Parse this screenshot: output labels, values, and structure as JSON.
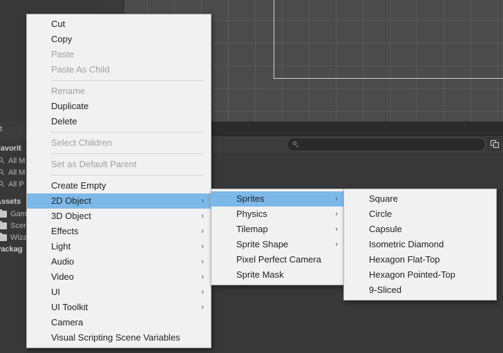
{
  "editor": {
    "project_panel": {
      "tab_label": "oject",
      "favorites_header": "Favorit",
      "favorites": [
        {
          "icon": "search-icon",
          "label": "All M"
        },
        {
          "icon": "search-icon",
          "label": "All M"
        },
        {
          "icon": "search-icon",
          "label": "All P"
        }
      ],
      "assets_header": "Assets",
      "assets": [
        {
          "icon": "folder-icon",
          "label": "Gam"
        },
        {
          "icon": "folder-icon",
          "label": "Scen"
        },
        {
          "icon": "folder-icon",
          "label": "Wiza"
        }
      ],
      "packages_header": "Packag"
    },
    "toolbar": {
      "search_placeholder": "",
      "search_value": "",
      "search_icon": "search-icon",
      "right_icon": "two-column-layout-icon"
    },
    "scene_view": {
      "grid": true,
      "camera_bounds": true
    }
  },
  "colors": {
    "menu_bg": "#f1f1f1",
    "menu_border": "#b4b4b4",
    "highlight": "#7cb9e8",
    "text": "#1e1e1e",
    "text_disabled": "#a0a0a0",
    "editor_bg": "#383838",
    "scene_bg": "#4b4b4b"
  },
  "menus": {
    "context_menu": {
      "name": "hierarchy-context-menu",
      "items": [
        {
          "label": "Cut",
          "disabled": false,
          "submenu": false,
          "highlight": false
        },
        {
          "label": "Copy",
          "disabled": false,
          "submenu": false,
          "highlight": false
        },
        {
          "label": "Paste",
          "disabled": true,
          "submenu": false,
          "highlight": false
        },
        {
          "label": "Paste As Child",
          "disabled": true,
          "submenu": false,
          "highlight": false
        },
        {
          "separator": true
        },
        {
          "label": "Rename",
          "disabled": true,
          "submenu": false,
          "highlight": false
        },
        {
          "label": "Duplicate",
          "disabled": false,
          "submenu": false,
          "highlight": false
        },
        {
          "label": "Delete",
          "disabled": false,
          "submenu": false,
          "highlight": false
        },
        {
          "separator": true
        },
        {
          "label": "Select Children",
          "disabled": true,
          "submenu": false,
          "highlight": false
        },
        {
          "separator": true
        },
        {
          "label": "Set as Default Parent",
          "disabled": true,
          "submenu": false,
          "highlight": false
        },
        {
          "separator": true
        },
        {
          "label": "Create Empty",
          "disabled": false,
          "submenu": false,
          "highlight": false
        },
        {
          "label": "2D Object",
          "disabled": false,
          "submenu": true,
          "highlight": true
        },
        {
          "label": "3D Object",
          "disabled": false,
          "submenu": true,
          "highlight": false
        },
        {
          "label": "Effects",
          "disabled": false,
          "submenu": true,
          "highlight": false
        },
        {
          "label": "Light",
          "disabled": false,
          "submenu": true,
          "highlight": false
        },
        {
          "label": "Audio",
          "disabled": false,
          "submenu": true,
          "highlight": false
        },
        {
          "label": "Video",
          "disabled": false,
          "submenu": true,
          "highlight": false
        },
        {
          "label": "UI",
          "disabled": false,
          "submenu": true,
          "highlight": false
        },
        {
          "label": "UI Toolkit",
          "disabled": false,
          "submenu": true,
          "highlight": false
        },
        {
          "label": "Camera",
          "disabled": false,
          "submenu": false,
          "highlight": false
        },
        {
          "label": "Visual Scripting Scene Variables",
          "disabled": false,
          "submenu": false,
          "highlight": false
        }
      ]
    },
    "submenu_2d_object": {
      "name": "2d-object-submenu",
      "items": [
        {
          "label": "Sprites",
          "disabled": false,
          "submenu": true,
          "highlight": true
        },
        {
          "label": "Physics",
          "disabled": false,
          "submenu": true,
          "highlight": false
        },
        {
          "label": "Tilemap",
          "disabled": false,
          "submenu": true,
          "highlight": false
        },
        {
          "label": "Sprite Shape",
          "disabled": false,
          "submenu": true,
          "highlight": false
        },
        {
          "label": "Pixel Perfect Camera",
          "disabled": false,
          "submenu": false,
          "highlight": false
        },
        {
          "label": "Sprite Mask",
          "disabled": false,
          "submenu": false,
          "highlight": false
        }
      ]
    },
    "submenu_sprites": {
      "name": "sprites-submenu",
      "items": [
        {
          "label": "Square",
          "disabled": false,
          "submenu": false,
          "highlight": false
        },
        {
          "label": "Circle",
          "disabled": false,
          "submenu": false,
          "highlight": false
        },
        {
          "label": "Capsule",
          "disabled": false,
          "submenu": false,
          "highlight": false
        },
        {
          "label": "Isometric Diamond",
          "disabled": false,
          "submenu": false,
          "highlight": false
        },
        {
          "label": "Hexagon Flat-Top",
          "disabled": false,
          "submenu": false,
          "highlight": false
        },
        {
          "label": "Hexagon Pointed-Top",
          "disabled": false,
          "submenu": false,
          "highlight": false
        },
        {
          "label": "9-Sliced",
          "disabled": false,
          "submenu": false,
          "highlight": false
        }
      ]
    }
  },
  "glyphs": {
    "submenu_arrow": "›"
  }
}
